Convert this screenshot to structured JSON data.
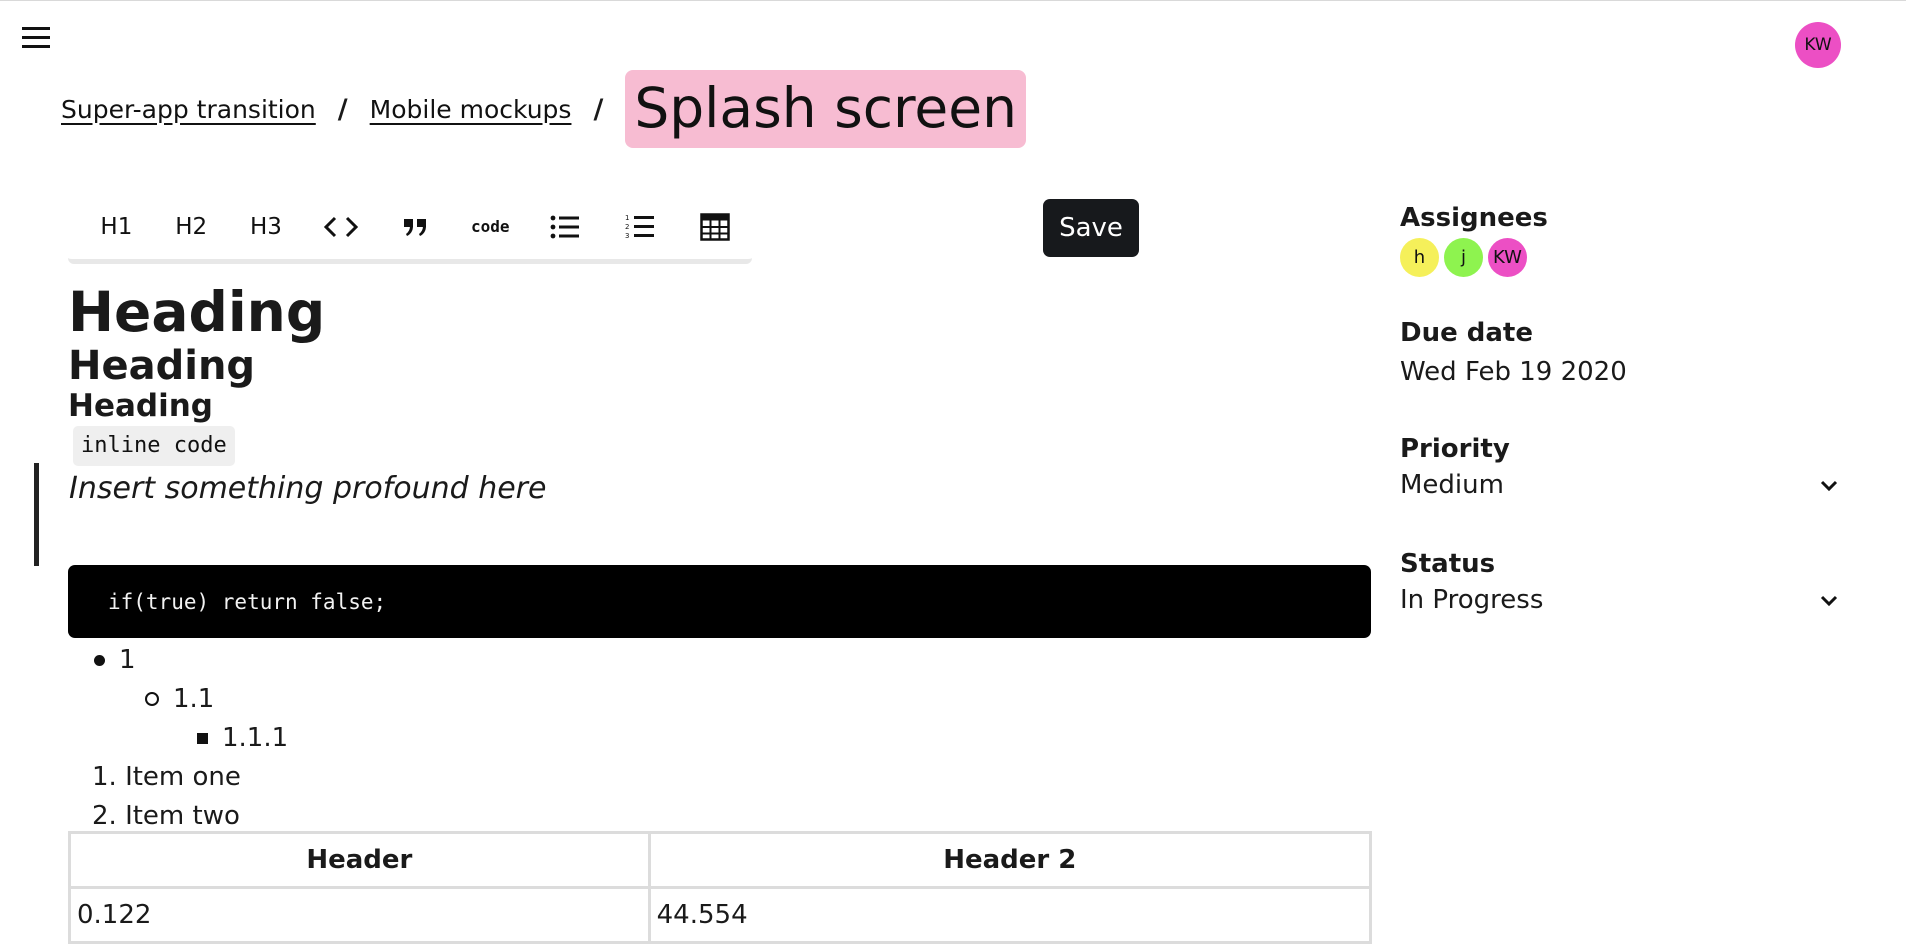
{
  "header": {
    "menu_icon": "hamburger-menu-icon",
    "user_initials": "KW",
    "user_avatar_color": "#ec4fc4"
  },
  "breadcrumb": {
    "items": [
      "Super-app transition",
      "Mobile mockups"
    ],
    "separator": "/",
    "current": "Splash screen",
    "current_highlight": "#f7bcd2"
  },
  "toolbar": {
    "h1": "H1",
    "h2": "H2",
    "h3": "H3",
    "code_label": "code",
    "save_label": "Save"
  },
  "editor": {
    "heading1": "Heading",
    "heading2": "Heading",
    "heading3": "Heading",
    "inline_code": "inline code",
    "quote": "Insert something profound here",
    "code_block": "if(true) return false;",
    "bullets": [
      "1",
      "1.1",
      "1.1.1"
    ],
    "ordered": [
      "1. Item one",
      "2. Item two"
    ],
    "table": {
      "headers": [
        "Header",
        "Header 2"
      ],
      "rows": [
        [
          "0.122",
          "44.554"
        ]
      ]
    }
  },
  "sidebar": {
    "assignees_label": "Assignees",
    "assignees": [
      {
        "initials": "h",
        "color": "#f5f05a"
      },
      {
        "initials": "j",
        "color": "#8ef34f"
      },
      {
        "initials": "KW",
        "color": "#ec4fc4"
      }
    ],
    "due_label": "Due date",
    "due_value": "Wed Feb 19 2020",
    "priority_label": "Priority",
    "priority_value": "Medium",
    "status_label": "Status",
    "status_value": "In Progress"
  }
}
